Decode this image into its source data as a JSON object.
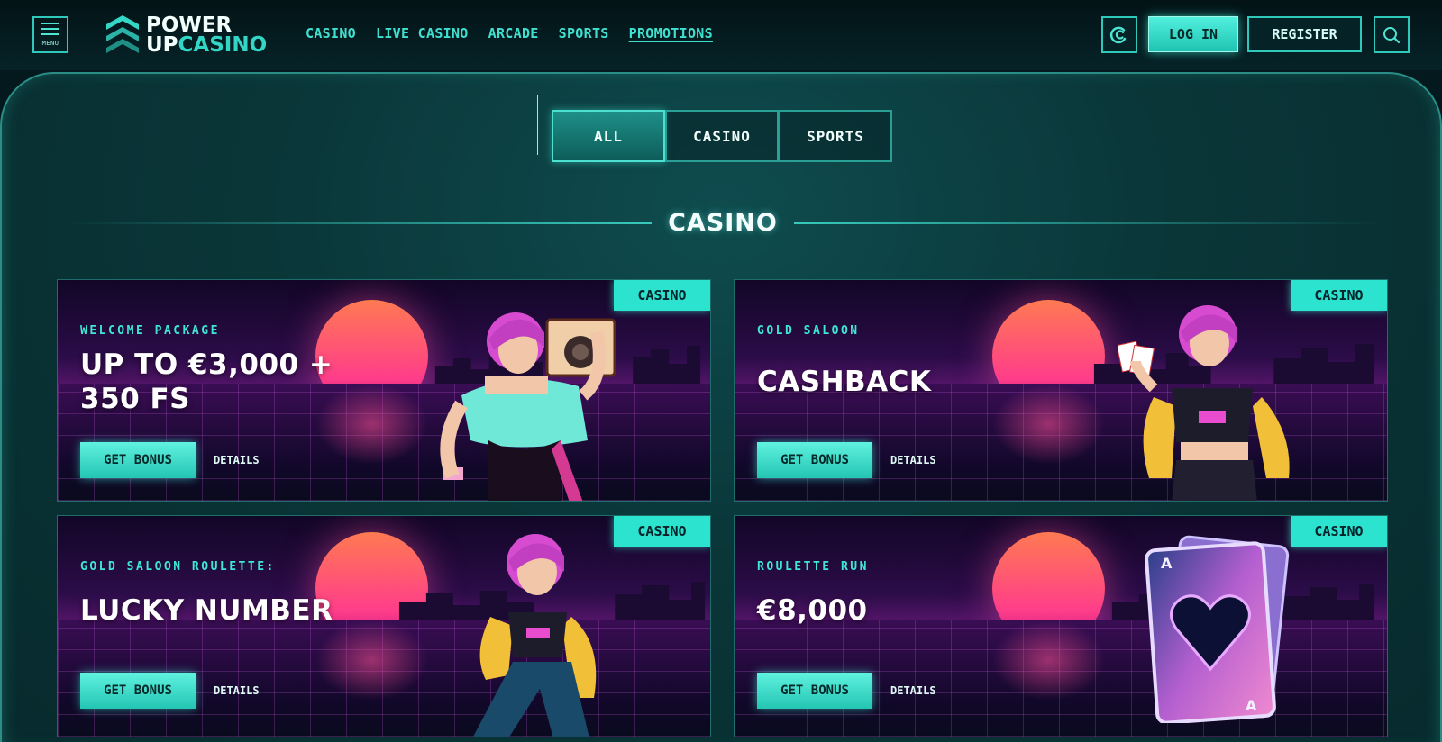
{
  "header": {
    "menu_label": "MENU",
    "logo": {
      "line1": "POWER",
      "line2_a": "UP",
      "line2_b": "CASINO"
    },
    "nav": [
      {
        "label": "CASINO",
        "active": false
      },
      {
        "label": "LIVE CASINO",
        "active": false
      },
      {
        "label": "ARCADE",
        "active": false
      },
      {
        "label": "SPORTS",
        "active": false
      },
      {
        "label": "PROMOTIONS",
        "active": true
      }
    ],
    "login_label": "LOG IN",
    "register_label": "REGISTER"
  },
  "tabs": [
    {
      "label": "ALL",
      "active": true
    },
    {
      "label": "CASINO",
      "active": false
    },
    {
      "label": "SPORTS",
      "active": false
    }
  ],
  "section_title": "CASINO",
  "cards": [
    {
      "badge": "CASINO",
      "eyebrow": "WELCOME PACKAGE",
      "headline_l1": "UP TO €3,000 +",
      "headline_l2": "350 FS",
      "cta": "GET BONUS",
      "details": "DETAILS",
      "art": "girl-with-boombox"
    },
    {
      "badge": "CASINO",
      "eyebrow": "GOLD SALOON",
      "headline_l1": "CASHBACK",
      "headline_l2": "",
      "cta": "GET BONUS",
      "details": "DETAILS",
      "art": "girl-with-cards"
    },
    {
      "badge": "CASINO",
      "eyebrow": "GOLD SALOON ROULETTE:",
      "headline_l1": "LUCKY NUMBER",
      "headline_l2": "",
      "cta": "GET BONUS",
      "details": "DETAILS",
      "art": "girl-sitting"
    },
    {
      "badge": "CASINO",
      "eyebrow": "ROULETTE RUN",
      "headline_l1": "€8,000",
      "headline_l2": "",
      "cta": "GET BONUS",
      "details": "DETAILS",
      "art": "ace-of-hearts-card"
    }
  ],
  "colors": {
    "accent": "#2ce3cf",
    "background": "#04191d",
    "panel": "#0a3638"
  }
}
